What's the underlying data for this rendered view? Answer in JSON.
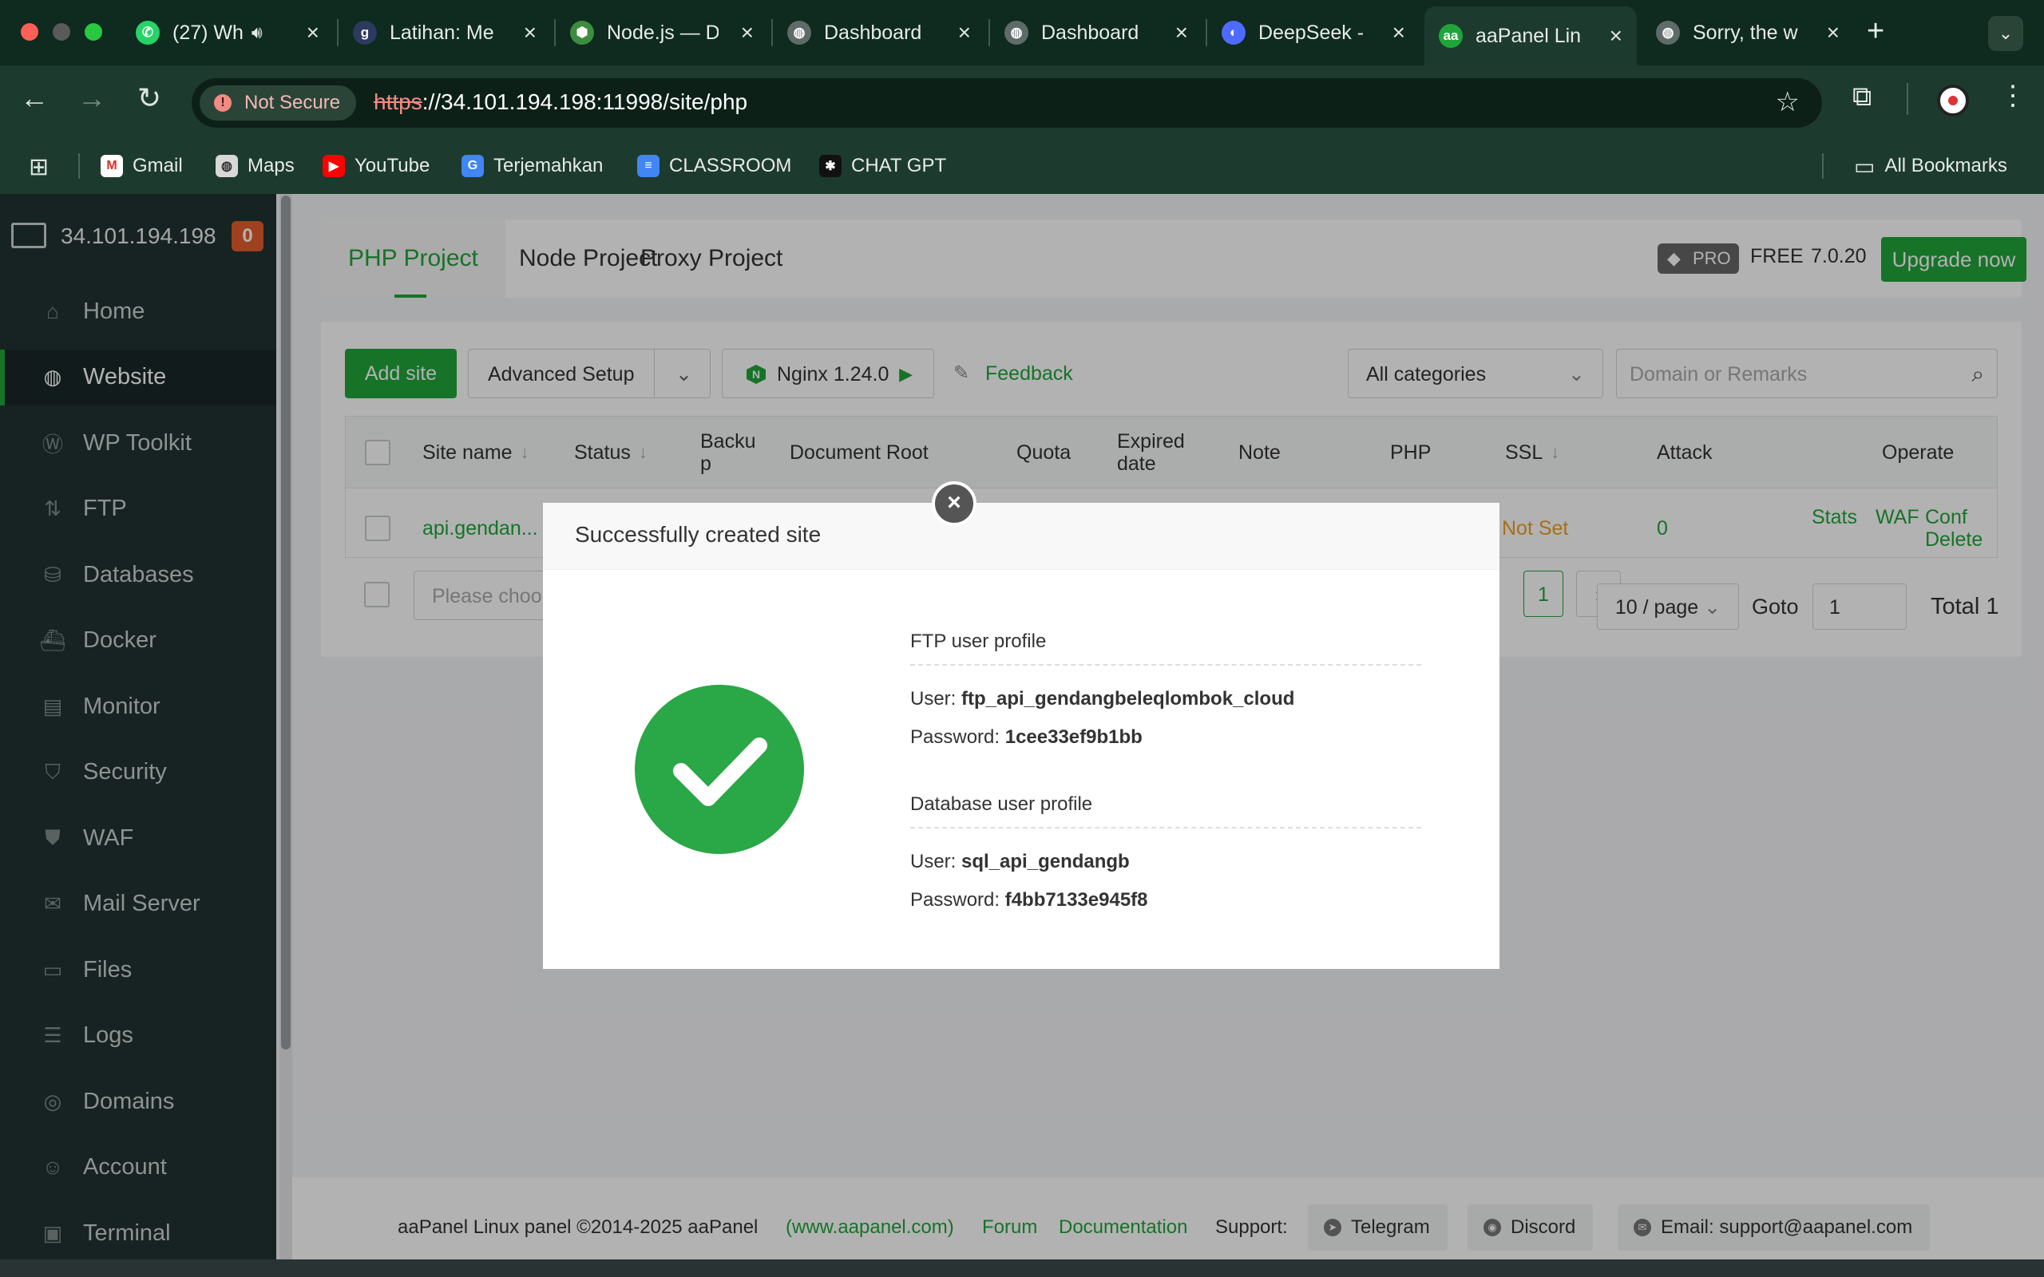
{
  "browser": {
    "tabs": [
      {
        "label": "(27) Wh",
        "icon": "whatsapp-icon",
        "color": "#25d366",
        "glyph": "✆",
        "audio": true
      },
      {
        "label": "Latihan: Me",
        "icon": "latihan-icon",
        "color": "#2b3a5e",
        "glyph": "g"
      },
      {
        "label": "Node.js — D",
        "icon": "nodejs-icon",
        "color": "#3c8d3f",
        "glyph": "⬢"
      },
      {
        "label": "Dashboard",
        "icon": "globe-icon",
        "color": "#5f6b68",
        "glyph": "◍"
      },
      {
        "label": "Dashboard",
        "icon": "globe-icon",
        "color": "#5f6b68",
        "glyph": "◍"
      },
      {
        "label": "DeepSeek -",
        "icon": "deepseek-icon",
        "color": "#4d6bfe",
        "glyph": "◐"
      },
      {
        "label": "aaPanel Lin",
        "icon": "aapanel-icon",
        "color": "#20a53a",
        "glyph": "aa",
        "active": true
      },
      {
        "label": "Sorry, the w",
        "icon": "globe-icon",
        "color": "#5f6b68",
        "glyph": "◍"
      }
    ],
    "security_label": "Not Secure",
    "url_scheme": "https",
    "url_rest": "://34.101.194.198:11998/site/php",
    "bookmarks": [
      {
        "label": "Gmail",
        "icon": "gmail-icon"
      },
      {
        "label": "Maps",
        "icon": "maps-icon"
      },
      {
        "label": "YouTube",
        "icon": "youtube-icon"
      },
      {
        "label": "Terjemahkan",
        "icon": "translate-icon"
      },
      {
        "label": "CLASSROOM",
        "icon": "classroom-icon"
      },
      {
        "label": "CHAT GPT",
        "icon": "chatgpt-icon"
      }
    ],
    "all_bookmarks": "All Bookmarks"
  },
  "sidebar": {
    "server_ip": "34.101.194.198",
    "server_badge": "0",
    "items": [
      {
        "label": "Home",
        "icon": "home-icon"
      },
      {
        "label": "Website",
        "icon": "globe-icon",
        "active": true
      },
      {
        "label": "WP Toolkit",
        "icon": "wordpress-icon"
      },
      {
        "label": "FTP",
        "icon": "ftp-icon"
      },
      {
        "label": "Databases",
        "icon": "database-icon"
      },
      {
        "label": "Docker",
        "icon": "docker-icon"
      },
      {
        "label": "Monitor",
        "icon": "monitor-icon"
      },
      {
        "label": "Security",
        "icon": "shield-icon"
      },
      {
        "label": "WAF",
        "icon": "waf-shield-icon"
      },
      {
        "label": "Mail Server",
        "icon": "mail-icon"
      },
      {
        "label": "Files",
        "icon": "folder-icon"
      },
      {
        "label": "Logs",
        "icon": "logs-icon"
      },
      {
        "label": "Domains",
        "icon": "domains-icon"
      },
      {
        "label": "Account",
        "icon": "account-icon"
      },
      {
        "label": "Terminal",
        "icon": "terminal-icon"
      }
    ]
  },
  "main": {
    "project_tabs": [
      "PHP Project",
      "Node Project",
      "Proxy Project"
    ],
    "pro_label": "PRO",
    "free_label": "FREE",
    "version": "7.0.20",
    "upgrade_label": "Upgrade now",
    "toolbar": {
      "add_site": "Add site",
      "advanced_setup": "Advanced Setup",
      "nginx": "Nginx 1.24.0",
      "feedback": "Feedback",
      "category": "All categories",
      "search_placeholder": "Domain or Remarks"
    },
    "table": {
      "headers": {
        "site_name": "Site name",
        "status": "Status",
        "backup_a": "Backu",
        "backup_b": "p",
        "doc_root": "Document Root",
        "quota": "Quota",
        "expired_a": "Expired",
        "expired_b": "date",
        "note": "Note",
        "php": "PHP",
        "ssl": "SSL",
        "attack": "Attack",
        "operate": "Operate"
      },
      "row": {
        "site_name": "api.gendan...",
        "ssl": "Not Set",
        "attack": "0",
        "ops": [
          "Stats",
          "WAF",
          "Conf",
          "Delete"
        ]
      }
    },
    "pagination": {
      "batch_placeholder": "Please choo",
      "current_page": "1",
      "next": "›",
      "per_page": "10 / page",
      "goto_label": "Goto",
      "goto_value": "1",
      "total": "Total 1"
    }
  },
  "footer": {
    "copyright": "aaPanel Linux panel ©2014-2025 aaPanel",
    "site_link": "(www.aapanel.com)",
    "forum": "Forum",
    "documentation": "Documentation",
    "support_label": "Support:",
    "telegram": "Telegram",
    "discord": "Discord",
    "email": "Email: support@aapanel.com"
  },
  "modal": {
    "title": "Successfully created site",
    "ftp_title": "FTP user profile",
    "ftp_user_label": "User:",
    "ftp_user": "ftp_api_gendangbeleqlombok_cloud",
    "ftp_pass_label": "Password:",
    "ftp_pass": "1cee33ef9b1bb",
    "db_title": "Database user profile",
    "db_user_label": "User:",
    "db_user": "sql_api_gendangb",
    "db_pass_label": "Password:",
    "db_pass": "f4bb7133e945f8"
  }
}
